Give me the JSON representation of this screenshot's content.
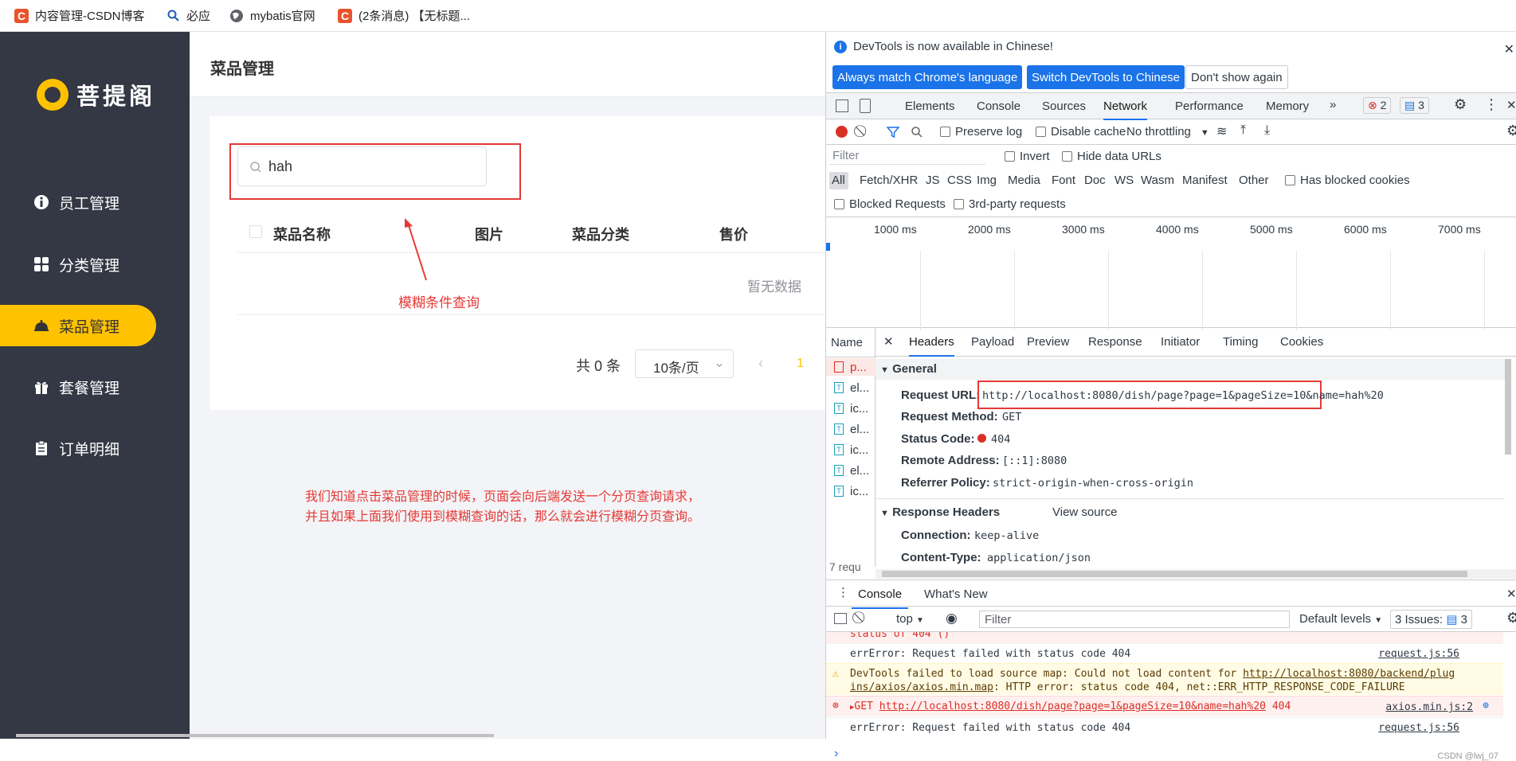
{
  "bookmarks": [
    {
      "label": "内容管理-CSDN博客"
    },
    {
      "label": "必应"
    },
    {
      "label": "mybatis官网"
    },
    {
      "label": "(2条消息) 【无标题..."
    }
  ],
  "sidebar": {
    "logo": "菩提阁",
    "items": [
      {
        "label": "员工管理"
      },
      {
        "label": "分类管理"
      },
      {
        "label": "菜品管理"
      },
      {
        "label": "套餐管理"
      },
      {
        "label": "订单明细"
      }
    ]
  },
  "main": {
    "title": "菜品管理",
    "search_value": "hah",
    "columns": [
      "菜品名称",
      "图片",
      "菜品分类",
      "售价"
    ],
    "empty_text": "暂无数据",
    "total": "共 0 条",
    "page_size": "10条/页",
    "current_page": "1"
  },
  "annotations": {
    "arrow_label": "模糊条件查询",
    "note_line1": "我们知道点击菜品管理的时候，页面会向后端发送一个分页查询请求，",
    "note_line2": "并且如果上面我们使用到模糊查询的话，那么就会进行模糊分页查询。"
  },
  "devtools": {
    "banner": "DevTools is now available in Chinese!",
    "btn_match": "Always match Chrome's language",
    "btn_switch": "Switch DevTools to Chinese",
    "btn_dont": "Don't show again",
    "tabs": [
      "Elements",
      "Console",
      "Sources",
      "Network",
      "Performance",
      "Memory"
    ],
    "errors": "2",
    "messages": "3",
    "preserve_log": "Preserve log",
    "disable_cache": "Disable cache",
    "throttling": "No throttling",
    "filter_placeholder": "Filter",
    "invert": "Invert",
    "hide_data": "Hide data URLs",
    "types": [
      "All",
      "Fetch/XHR",
      "JS",
      "CSS",
      "Img",
      "Media",
      "Font",
      "Doc",
      "WS",
      "Wasm",
      "Manifest",
      "Other"
    ],
    "blocked_cookies": "Has blocked cookies",
    "blocked_requests": "Blocked Requests",
    "third_party": "3rd-party requests",
    "timeline": [
      "1000 ms",
      "2000 ms",
      "3000 ms",
      "4000 ms",
      "5000 ms",
      "6000 ms",
      "7000 ms"
    ],
    "name_col": "Name",
    "detail_tabs": [
      "Headers",
      "Payload",
      "Preview",
      "Response",
      "Initiator",
      "Timing",
      "Cookies"
    ],
    "requests": [
      "p...",
      "el...",
      "ic...",
      "el...",
      "ic...",
      "el...",
      "ic..."
    ],
    "req_count": "7 requ",
    "general": "General",
    "request_url_k": "Request URL:",
    "request_url": "http://localhost:8080/dish/page?page=1&pageSize=10&name=hah%20",
    "method_k": "Request Method:",
    "method": "GET",
    "status_k": "Status Code:",
    "status": "404",
    "remote_k": "Remote Address:",
    "remote": "[::1]:8080",
    "referrer_k": "Referrer Policy:",
    "referrer": "strict-origin-when-cross-origin",
    "resp_headers": "Response Headers",
    "view_source": "View source",
    "conn_k": "Connection:",
    "conn": "keep-alive",
    "ctype_k": "Content-Type:",
    "ctype": "application/json",
    "console_tab": "Console",
    "whats_new": "What's New",
    "top": "top",
    "console_filter": "Filter",
    "default_levels": "Default levels",
    "issues": "3 Issues:",
    "issues_n": "3",
    "log0": "status of 404 ()",
    "log1": "errError: Request failed with status code 404",
    "log1_src": "request.js:56",
    "warn_a": "DevTools failed to load source map: Could not load content for ",
    "warn_link1": "http://localhost:8080/backend/plug",
    "warn_link2": "ins/axios/axios.min.map",
    "warn_b": ": HTTP error: status code 404, net::ERR_HTTP_RESPONSE_CODE_FAILURE",
    "err_get": "GET",
    "err_url": "http://localhost:8080/dish/page?page=1&pageSize=10&name=hah%20",
    "err_code": "404",
    "err_src": "axios.min.js:2",
    "log2": "errError: Request failed with status code 404",
    "log2_src": "request.js:56",
    "watermark": "CSDN @lwj_07"
  }
}
